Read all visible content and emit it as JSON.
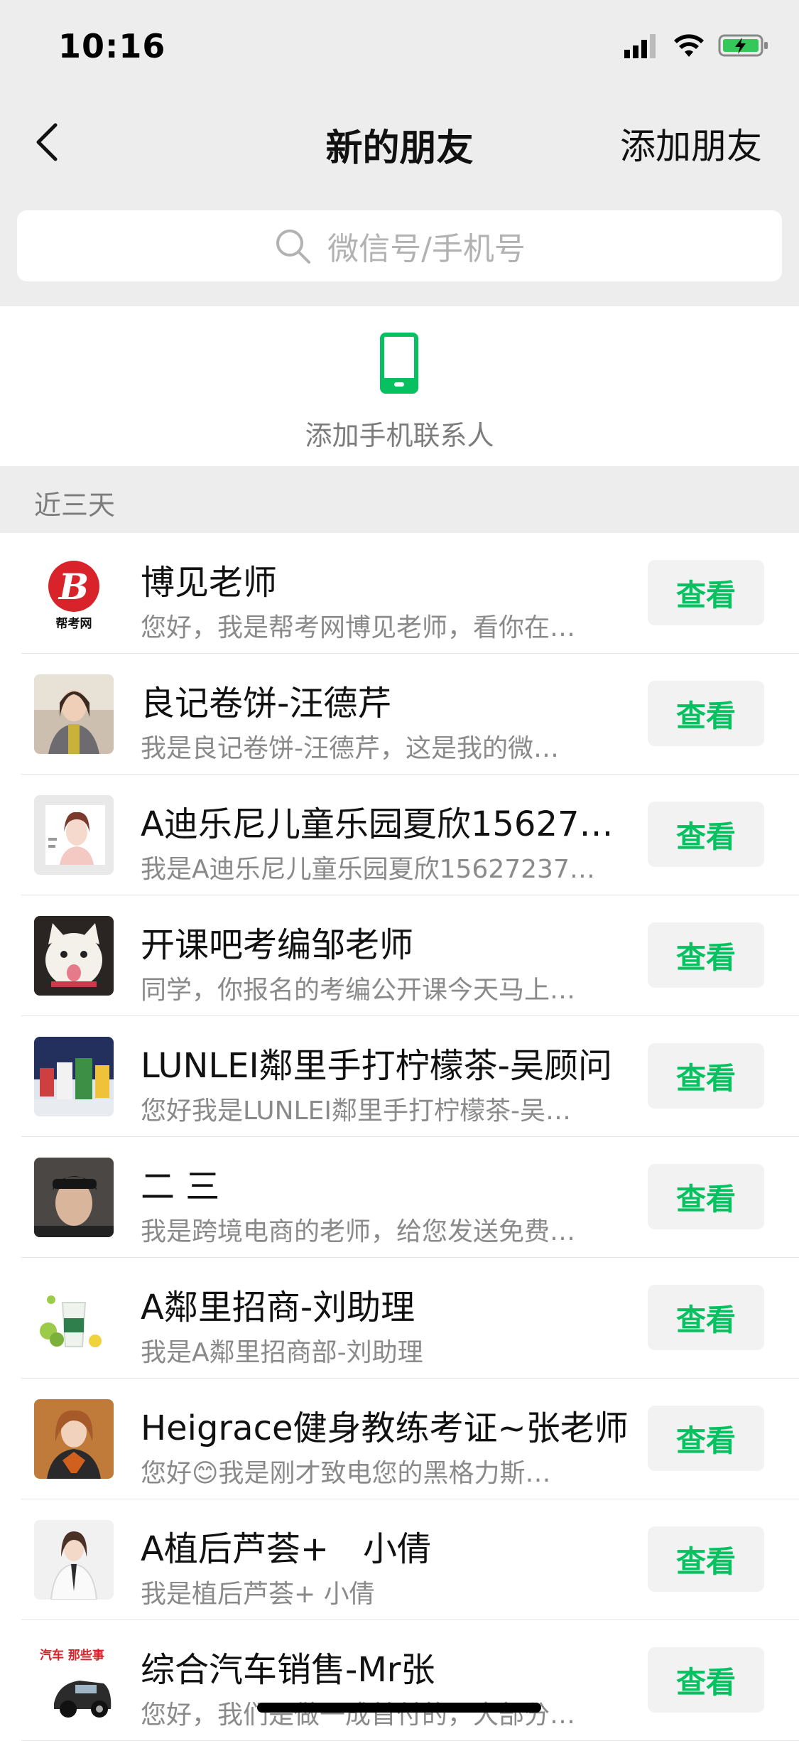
{
  "status_bar": {
    "time": "10:16"
  },
  "nav": {
    "title": "新的朋友",
    "action_label": "添加朋友"
  },
  "search": {
    "placeholder": "微信号/手机号"
  },
  "add_phone": {
    "label": "添加手机联系人"
  },
  "section": {
    "title": "近三天"
  },
  "view_label": "查看",
  "friends": [
    {
      "name": "博见老师",
      "message": "您好，我是帮考网博见老师，看你在…",
      "avatar_text": "帮考网"
    },
    {
      "name": "良记卷饼-汪德芹",
      "message": "我是良记卷饼-汪德芹，这是我的微…"
    },
    {
      "name": "A迪乐尼儿童乐园夏欣15627…",
      "message": "我是A迪乐尼儿童乐园夏欣15627237…"
    },
    {
      "name": "开课吧考编邹老师",
      "message": "同学，你报名的考编公开课今天马上…"
    },
    {
      "name": "LUNLEI鄰里手打柠檬茶-吴顾问",
      "message": "您好我是LUNLEI鄰里手打柠檬茶-吴…"
    },
    {
      "name": "二 三",
      "message": "我是跨境电商的老师，给您发送免费…"
    },
    {
      "name": "A鄰里招商-刘助理",
      "message": "我是A鄰里招商部-刘助理"
    },
    {
      "name": "Heigrace健身教练考证~张老师",
      "message": "您好😊我是刚才致电您的黑格力斯…"
    },
    {
      "name": "A植后芦荟+　小倩",
      "message": "我是植后芦荟+ 小倩"
    },
    {
      "name": "综合汽车销售-Mr张",
      "message": "您好，我们是做一成首付的，大部分…",
      "avatar_text": "汽车 那些事"
    }
  ],
  "colors": {
    "accent": "#07c160",
    "nav_background": "#ededed",
    "secondary_text": "#8a8a8a"
  }
}
